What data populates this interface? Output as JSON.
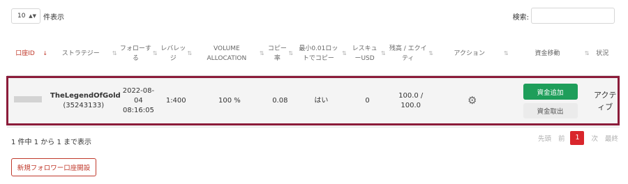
{
  "top": {
    "length_value": "10",
    "length_label": "件表示",
    "search_label": "検索:",
    "search_value": ""
  },
  "table": {
    "headers": [
      "口座ID",
      "ストラテジー",
      "フォローする",
      "レバレッジ",
      "VOLUME ALLOCATION",
      "コピー率",
      "最小0.01ロットでコピー",
      "レスキューUSD",
      "残高 / エクイティ",
      "アクション",
      "資金移動",
      "状況"
    ],
    "rows": [
      {
        "strategy_name": "TheLegendOfGold",
        "strategy_id": "(35243133)",
        "follow_date": "2022-08-04",
        "follow_time": "08:16:05",
        "leverage": "1:400",
        "volume_allocation": "100 %",
        "copy_rate": "0.08",
        "min_lot": "はい",
        "rescue_usd": "0",
        "balance": "100.0 /",
        "equity": "100.0",
        "add_funds_label": "資金追加",
        "withdraw_label": "資金取出",
        "status": "アクティブ"
      }
    ]
  },
  "footer": {
    "info": "1 件中 1 から 1 まで表示",
    "pagination": {
      "first": "先頭",
      "prev": "前",
      "current": "1",
      "next": "次",
      "last": "最終"
    },
    "new_account_label": "新規フォロワー口座開設"
  },
  "icons": {
    "sort": "sort-arrows-icon",
    "action": "gear-icon",
    "select_caret": "chevron-updown-icon"
  },
  "colors": {
    "accent_red": "#c0392b",
    "highlight_border": "#8b1c3a",
    "add_funds_green": "#1e9e5a",
    "page_active": "#d9262c"
  }
}
